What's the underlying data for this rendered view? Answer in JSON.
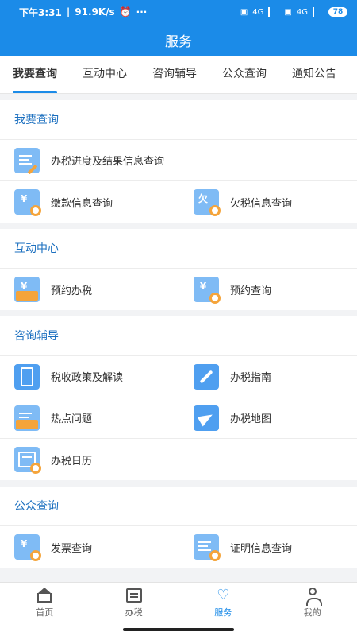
{
  "status_bar": {
    "time": "下午3:31",
    "speed": "91.9K/s",
    "more": "···",
    "network_1": "4G",
    "network_2": "4G",
    "battery": "78"
  },
  "header": {
    "title": "服务"
  },
  "tabs": [
    {
      "label": "我要查询",
      "active": true
    },
    {
      "label": "互动中心"
    },
    {
      "label": "咨询辅导"
    },
    {
      "label": "公众查询"
    },
    {
      "label": "通知公告"
    }
  ],
  "sections": {
    "query": {
      "title": "我要查询",
      "items": [
        "办税进度及结果信息查询",
        "缴款信息查询",
        "欠税信息查询"
      ]
    },
    "interaction": {
      "title": "互动中心",
      "items": [
        "预约办税",
        "预约查询"
      ]
    },
    "consult": {
      "title": "咨询辅导",
      "items": [
        "税收政策及解读",
        "办税指南",
        "热点问题",
        "办税地图",
        "办税日历"
      ]
    },
    "public": {
      "title": "公众查询",
      "items": [
        "发票查询",
        "证明信息查询"
      ]
    }
  },
  "icons": {
    "yen_glyph": "¥",
    "owe_glyph": "欠"
  },
  "bottom_nav": [
    {
      "label": "首页",
      "icon": "home-icon"
    },
    {
      "label": "办税",
      "icon": "list-icon"
    },
    {
      "label": "服务",
      "icon": "heart-icon",
      "active": true
    },
    {
      "label": "我的",
      "icon": "user-icon"
    }
  ],
  "colors": {
    "primary": "#1b8be8",
    "accent": "#f5a43a",
    "section_title": "#1b6fbf"
  }
}
